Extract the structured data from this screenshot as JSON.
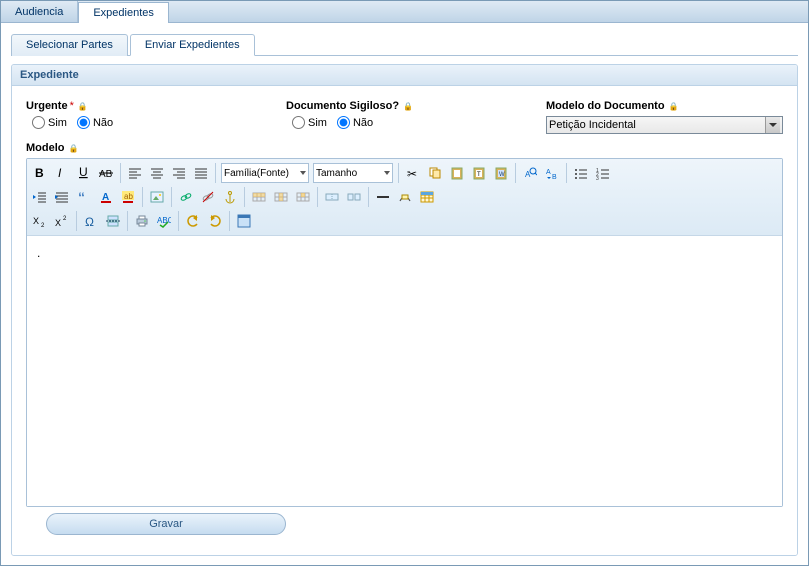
{
  "top_tabs": [
    {
      "label": "Audiencia",
      "active": false
    },
    {
      "label": "Expedientes",
      "active": true
    }
  ],
  "sub_tabs": [
    {
      "label": "Selecionar Partes",
      "active": false
    },
    {
      "label": "Enviar Expedientes",
      "active": true
    }
  ],
  "panel": {
    "title": "Expediente"
  },
  "fields": {
    "urgente": {
      "label": "Urgente",
      "required": "*",
      "options": {
        "sim": "Sim",
        "nao": "Não"
      },
      "value": "nao"
    },
    "sigiloso": {
      "label": "Documento Sigiloso?",
      "options": {
        "sim": "Sim",
        "nao": "Não"
      },
      "value": "nao"
    },
    "modeloDoc": {
      "label": "Modelo do Documento",
      "value": "Petição Incidental"
    },
    "modelo": {
      "label": "Modelo"
    }
  },
  "toolbar": {
    "fontFamily": "Família(Fonte)",
    "fontSize": "Tamanho"
  },
  "editor": {
    "content": "."
  },
  "buttons": {
    "save": "Gravar"
  }
}
